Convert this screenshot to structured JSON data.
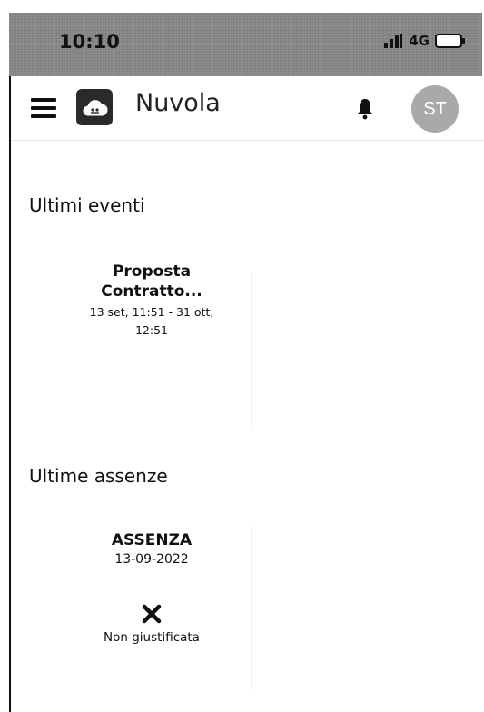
{
  "status_bar": {
    "time": "10:10",
    "network": "4G"
  },
  "header": {
    "app_name": "Nuvola",
    "avatar_initials": "ST"
  },
  "events": {
    "section_title": "Ultimi eventi",
    "items": [
      {
        "title_line1": "Proposta",
        "title_line2": "Contratto...",
        "dates_line1": "13 set, 11:51 - 31 ott,",
        "dates_line2": "12:51"
      }
    ]
  },
  "absences": {
    "section_title": "Ultime assenze",
    "items": [
      {
        "type": "ASSENZA",
        "date": "13-09-2022",
        "status": "Non giustificata",
        "status_icon": "x-icon"
      }
    ]
  }
}
